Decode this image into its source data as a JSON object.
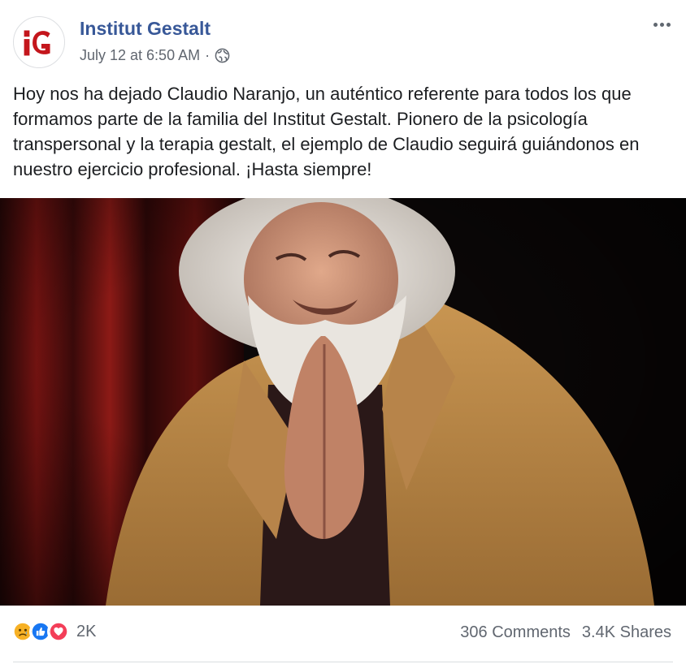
{
  "post": {
    "author": "Institut Gestalt",
    "timestamp": "July 12 at 6:50 AM",
    "separator": "·",
    "privacy_icon": "globe-icon",
    "more_icon": "more-options-icon",
    "avatar_icon": "institut-gestalt-logo",
    "message": "Hoy nos ha dejado Claudio Naranjo, un auténtico referente para todos los que formamos parte de la familia del Institut Gestalt. Pionero de la psicología transpersonal y la terapia gestalt, el ejemplo de Claudio seguirá guiándonos en nuestro ejercicio profesional. ¡Hasta siempre!"
  },
  "footer": {
    "reactions": [
      "sad",
      "like",
      "love"
    ],
    "reaction_count": "2K",
    "comments": "306 Comments",
    "shares": "3.4K Shares"
  },
  "colors": {
    "author_link": "#385898",
    "brand_red": "#c4161c",
    "like_blue": "#1877f2",
    "love_red": "#f33e58",
    "sad_yellow": "#f7b125"
  }
}
